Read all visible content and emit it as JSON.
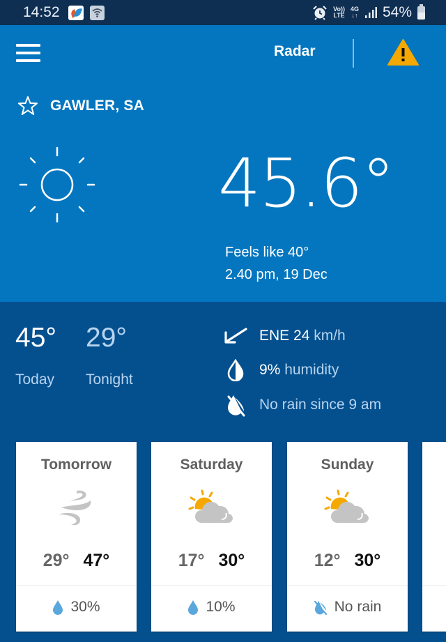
{
  "status_bar": {
    "time": "14:52",
    "lte_label_top": "Vo))",
    "lte_label_bottom": "LTE",
    "net_top": "4G",
    "net_bottom": "↓↑",
    "battery": "54%",
    "battery_level": 0.54,
    "icons": [
      "app-notification-icon",
      "wifi-icon",
      "alarm-icon",
      "volte-icon",
      "4g-icon",
      "signal-icon",
      "battery-icon"
    ]
  },
  "header": {
    "menu_icon": "hamburger-menu-icon",
    "radar_label": "Radar",
    "warning_icon": "warning-triangle-icon",
    "warning_color": "#f5a800"
  },
  "location": {
    "favourite_icon": "star-outline-icon",
    "name": "GAWLER, SA"
  },
  "current": {
    "icon": "sunny-icon",
    "temperature": "45.6°",
    "feels_like": "Feels like 40°",
    "observed": "2.40 pm, 19 Dec"
  },
  "today": {
    "today_temp": "45°",
    "today_label": "Today",
    "tonight_temp": "29°",
    "tonight_label": "Tonight"
  },
  "details": {
    "wind": {
      "icon": "wind-direction-arrow-icon",
      "direction_speed": "ENE 24",
      "unit": " km/h"
    },
    "humidity": {
      "icon": "humidity-drop-icon",
      "value": "9%",
      "label": " humidity"
    },
    "rain": {
      "icon": "no-rain-icon",
      "text": "No rain since 9 am"
    }
  },
  "forecast": [
    {
      "day": "Tomorrow",
      "icon": "windy-icon",
      "min": "29°",
      "max": "47°",
      "rain_icon": "rain-drop-icon",
      "rain": "30%"
    },
    {
      "day": "Saturday",
      "icon": "partly-cloudy-icon",
      "min": "17°",
      "max": "30°",
      "rain_icon": "rain-drop-icon",
      "rain": "10%"
    },
    {
      "day": "Sunday",
      "icon": "partly-cloudy-icon",
      "min": "12°",
      "max": "30°",
      "rain_icon": "no-rain-icon",
      "rain": "No rain"
    }
  ],
  "colors": {
    "status_bar": "#0e2e52",
    "hero_blue": "#0376bf",
    "details_blue": "#04508f",
    "soft_text": "#b7d4ef",
    "sun_yellow": "#f5a800",
    "cloud_grey": "#c4c4c4",
    "drop_blue": "#5aa7dc"
  }
}
